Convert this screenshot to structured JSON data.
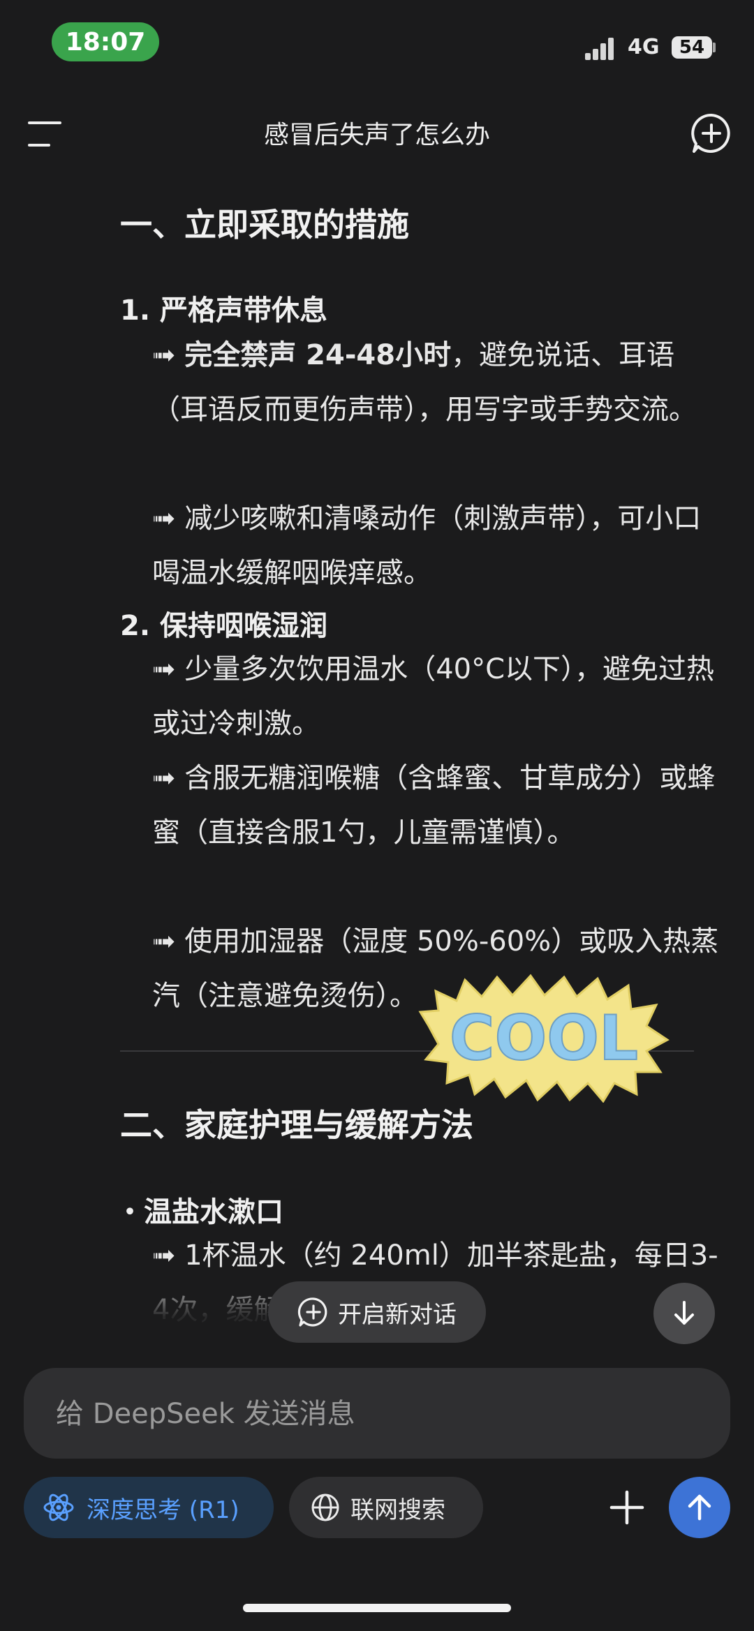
{
  "status_bar": {
    "time": "18:07",
    "network": "4G",
    "battery": "54"
  },
  "header": {
    "title": "感冒后失声了怎么办"
  },
  "content": {
    "section1_heading": "一、立即采取的措施",
    "item1_title": "1. 严格声带休息",
    "item1_p1_arrow": "➟",
    "item1_p1_bold": "完全禁声 24-48小时",
    "item1_p1_rest": "，避免说话、耳语（耳语反而更伤声带），用写字或手势交流。",
    "item1_p2": "➟ 减少咳嗽和清嗓动作（刺激声带），可小口喝温水缓解咽喉痒感。",
    "item2_title": "2. 保持咽喉湿润",
    "item2_p1": "➟ 少量多次饮用温水（40°C以下），避免过热或过冷刺激。",
    "item2_p2": "➟ 含服无糖润喉糖（含蜂蜜、甘草成分）或蜂蜜（直接含服1勺，儿童需谨慎）。",
    "item2_p3": "➟ 使用加湿器（湿度 50%-60%）或吸入热蒸汽（注意避免烫伤）。",
    "sticker_text": "COOL",
    "section2_heading": "二、家庭护理与缓解方法",
    "bullet1_title": "・温盐水漱口",
    "bullet1_p1": "➟ 1杯温水（约 240ml）加半茶匙盐，每日3-4次，缓解喉咙肿胀。"
  },
  "floating": {
    "new_chat_label": "开启新对话"
  },
  "input": {
    "placeholder": "给 DeepSeek 发送消息"
  },
  "toolbar": {
    "deep_think_label": "深度思考 (R1)",
    "web_search_label": "联网搜索"
  },
  "colors": {
    "accent": "#3d73d6",
    "deep_think_text": "#5aa0ff",
    "time_pill": "#3aa44c"
  }
}
